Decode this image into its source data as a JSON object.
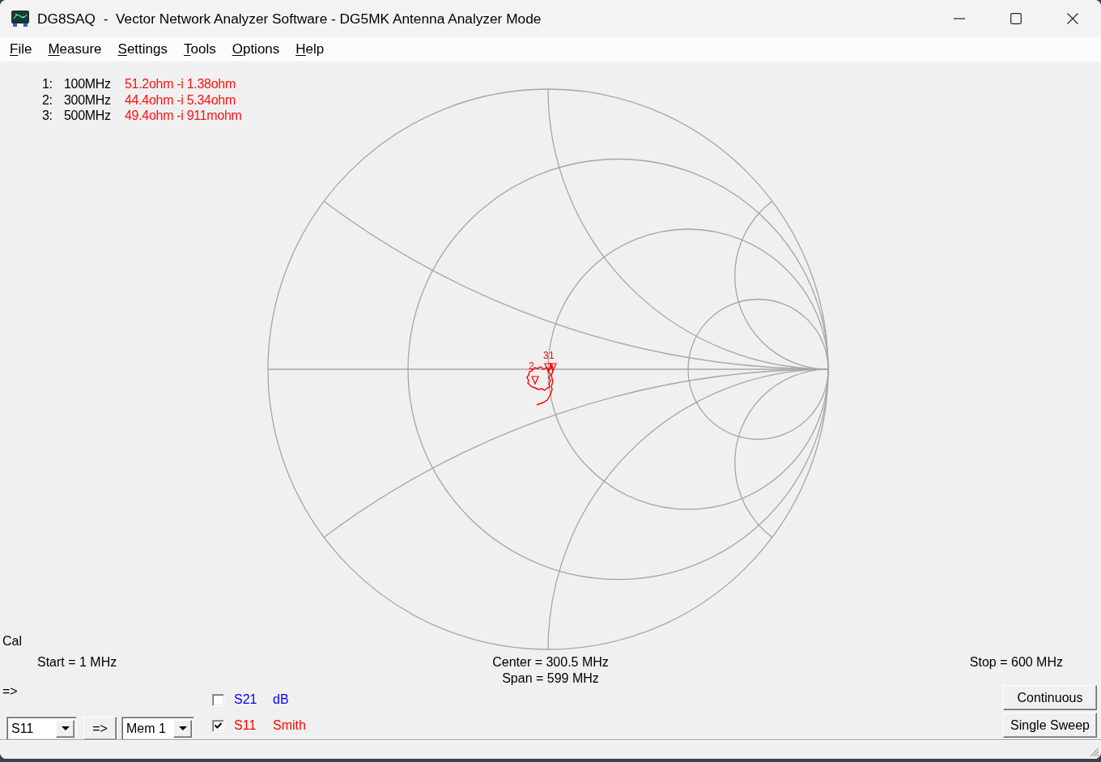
{
  "window": {
    "title": "DG8SAQ  -  Vector Network Analyzer Software - DG5MK Antenna Analyzer Mode"
  },
  "menu": [
    {
      "label": "File"
    },
    {
      "label": "Measure"
    },
    {
      "label": "Settings"
    },
    {
      "label": "Tools"
    },
    {
      "label": "Options"
    },
    {
      "label": "Help"
    }
  ],
  "marker_readouts": [
    {
      "index": "1:",
      "frequency": "100MHz",
      "impedance": "51.2ohm -i 1.38ohm"
    },
    {
      "index": "2:",
      "frequency": "300MHz",
      "impedance": "44.4ohm -i 5.34ohm"
    },
    {
      "index": "3:",
      "frequency": "500MHz",
      "impedance": "49.4ohm -i 911mohm"
    }
  ],
  "chart": {
    "marker_labels": [
      "3",
      "1",
      "2"
    ]
  },
  "cal_label": "Cal",
  "sweep": {
    "start": "Start = 1 MHz",
    "center": "Center = 300.5 MHz",
    "span": "Span = 599 MHz",
    "stop": "Stop = 600 MHz"
  },
  "copy_label": "=>",
  "parameter_select": {
    "value": "S11"
  },
  "copy_button": {
    "label": "=>"
  },
  "memory_select": {
    "value": "Mem 1"
  },
  "traces": [
    {
      "name": "S21",
      "format": "dB",
      "checked": false,
      "color": "#0000ff"
    },
    {
      "name": "S11",
      "format": "Smith",
      "checked": true,
      "color": "#ff0000"
    }
  ],
  "sweep_buttons": [
    {
      "label": "Continuous"
    },
    {
      "label": "Single Sweep"
    }
  ]
}
